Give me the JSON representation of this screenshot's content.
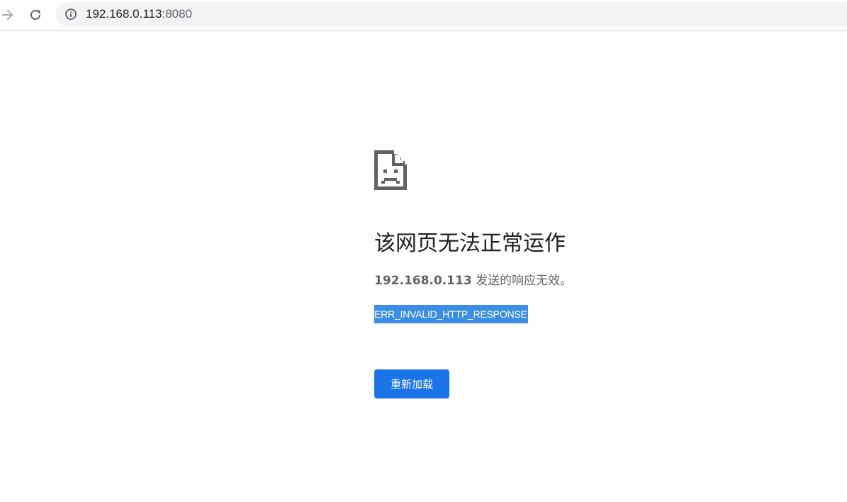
{
  "browser": {
    "address_bar": {
      "host": "192.168.0.113",
      "port": ":8080"
    },
    "icons": {
      "forward": "arrow-forward-icon",
      "reload": "reload-icon",
      "site_info": "info-icon"
    }
  },
  "error_page": {
    "icon": "sad-file-icon",
    "heading": "该网页无法正常运作",
    "summary_host": "192.168.0.113",
    "summary_rest": " 发送的响应无效。",
    "error_code": "ERR_INVALID_HTTP_RESPONSE",
    "reload_label": "重新加载"
  },
  "colors": {
    "button_blue": "#1a73e8",
    "selection_blue": "#3a8ee6",
    "heading_text": "#202124",
    "secondary_text": "#5f6368",
    "omnibox_bg": "#f1f3f4"
  }
}
